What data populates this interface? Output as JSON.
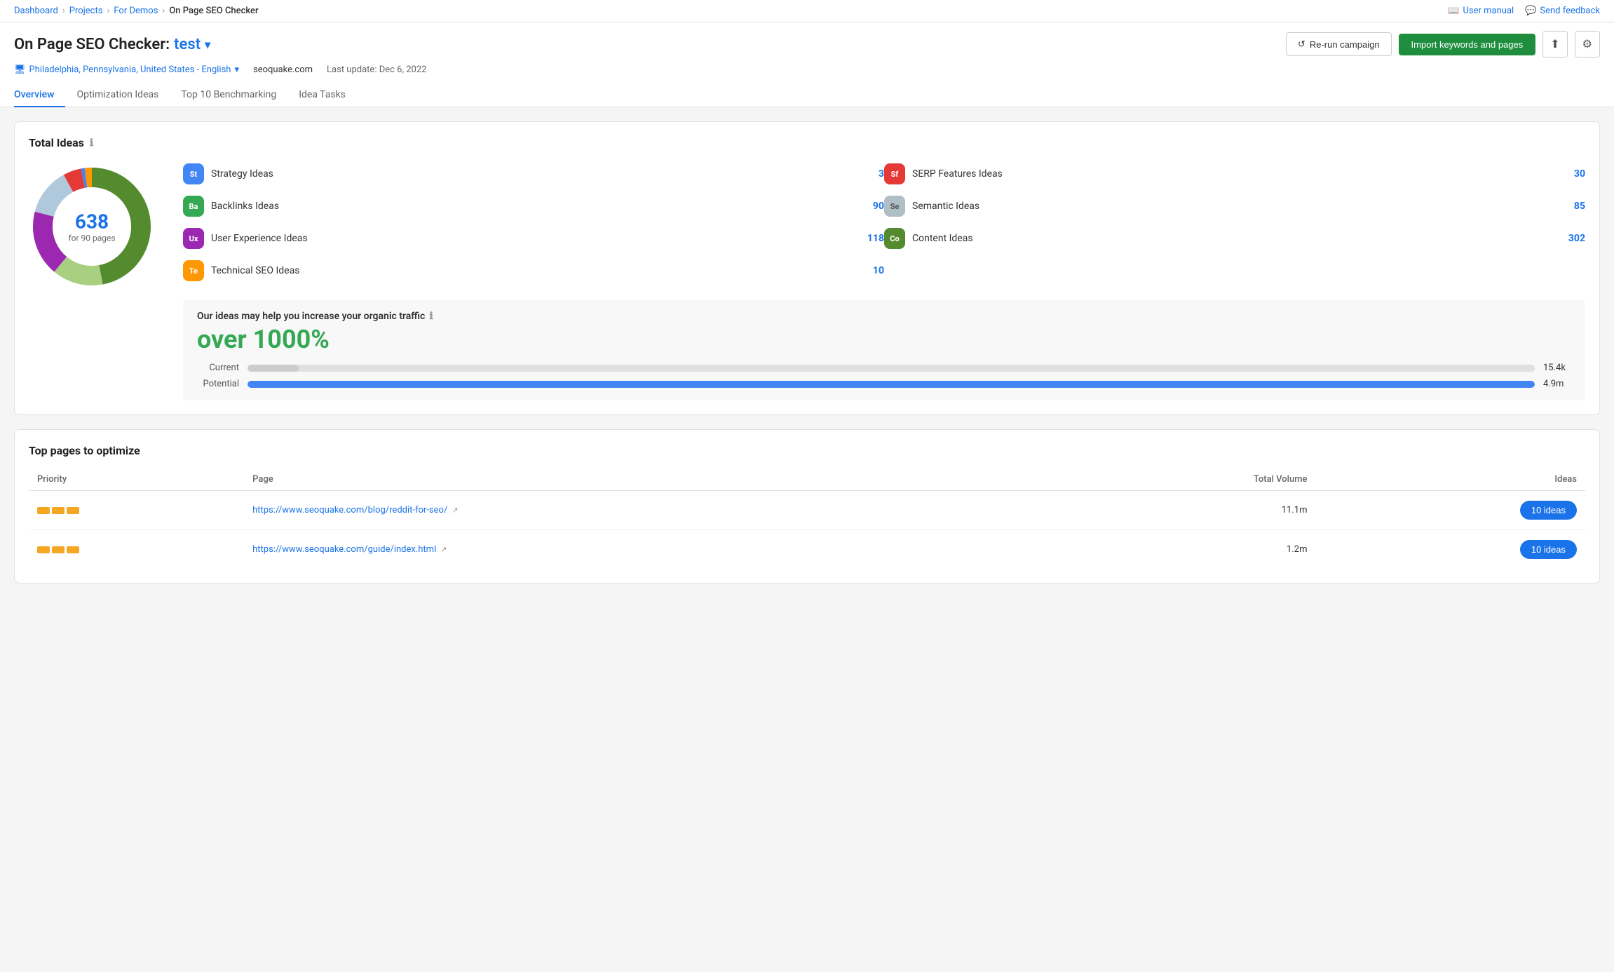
{
  "topbar": {
    "breadcrumb": [
      "Dashboard",
      "Projects",
      "For Demos",
      "On Page SEO Checker"
    ],
    "user_manual": "User manual",
    "send_feedback": "Send feedback"
  },
  "header": {
    "title_prefix": "On Page SEO Checker:",
    "project_name": "test",
    "location": "Philadelphia, Pennsylvania, United States - English",
    "domain": "seoquake.com",
    "last_update": "Last update: Dec 6, 2022",
    "btn_rerun": "Re-run campaign",
    "btn_import": "Import keywords and pages"
  },
  "tabs": [
    {
      "label": "Overview",
      "active": true
    },
    {
      "label": "Optimization Ideas",
      "active": false
    },
    {
      "label": "Top 10 Benchmarking",
      "active": false
    },
    {
      "label": "Idea Tasks",
      "active": false
    }
  ],
  "total_ideas": {
    "title": "Total Ideas",
    "donut_number": "638",
    "donut_sub": "for 90 pages",
    "ideas_left": [
      {
        "badge": "St",
        "badge_class": "badge-st",
        "label": "Strategy Ideas",
        "count": "3"
      },
      {
        "badge": "Ba",
        "badge_class": "badge-ba",
        "label": "Backlinks Ideas",
        "count": "90"
      },
      {
        "badge": "Ux",
        "badge_class": "badge-ux",
        "label": "User Experience Ideas",
        "count": "118"
      },
      {
        "badge": "Te",
        "badge_class": "badge-te",
        "label": "Technical SEO Ideas",
        "count": "10"
      }
    ],
    "ideas_right": [
      {
        "badge": "Sf",
        "badge_class": "badge-sf",
        "label": "SERP Features Ideas",
        "count": "30"
      },
      {
        "badge": "Se",
        "badge_class": "badge-se",
        "label": "Semantic Ideas",
        "count": "85"
      },
      {
        "badge": "Co",
        "badge_class": "badge-co",
        "label": "Content Ideas",
        "count": "302"
      }
    ],
    "traffic": {
      "title": "Our ideas may help you increase your organic traffic",
      "percent": "over 1000%",
      "current_label": "Current",
      "current_value": "15.4k",
      "current_pct": 4,
      "potential_label": "Potential",
      "potential_value": "4.9m",
      "potential_pct": 100
    }
  },
  "top_pages": {
    "title": "Top pages to optimize",
    "columns": [
      "Priority",
      "Page",
      "Total Volume",
      "Ideas"
    ],
    "rows": [
      {
        "priority": 3,
        "url": "https://www.seoquake.com/blog/reddit-for-seo/",
        "volume": "11.1m",
        "ideas": "10 ideas"
      },
      {
        "priority": 3,
        "url": "https://www.seoquake.com/guide/index.html",
        "volume": "1.2m",
        "ideas": "10 ideas"
      }
    ]
  },
  "donut": {
    "segments": [
      {
        "label": "Content",
        "color": "#558b2f",
        "pct": 47
      },
      {
        "label": "User Experience",
        "color": "#9c27b0",
        "pct": 18
      },
      {
        "label": "Semantic",
        "color": "#b0c0d0",
        "pct": 13
      },
      {
        "label": "Backlinks",
        "color": "#a8d080",
        "pct": 14
      },
      {
        "label": "SERP Features",
        "color": "#e53935",
        "pct": 5
      },
      {
        "label": "Strategy",
        "color": "#4285f4",
        "pct": 1
      },
      {
        "label": "Technical",
        "color": "#ff9800",
        "pct": 2
      }
    ]
  }
}
